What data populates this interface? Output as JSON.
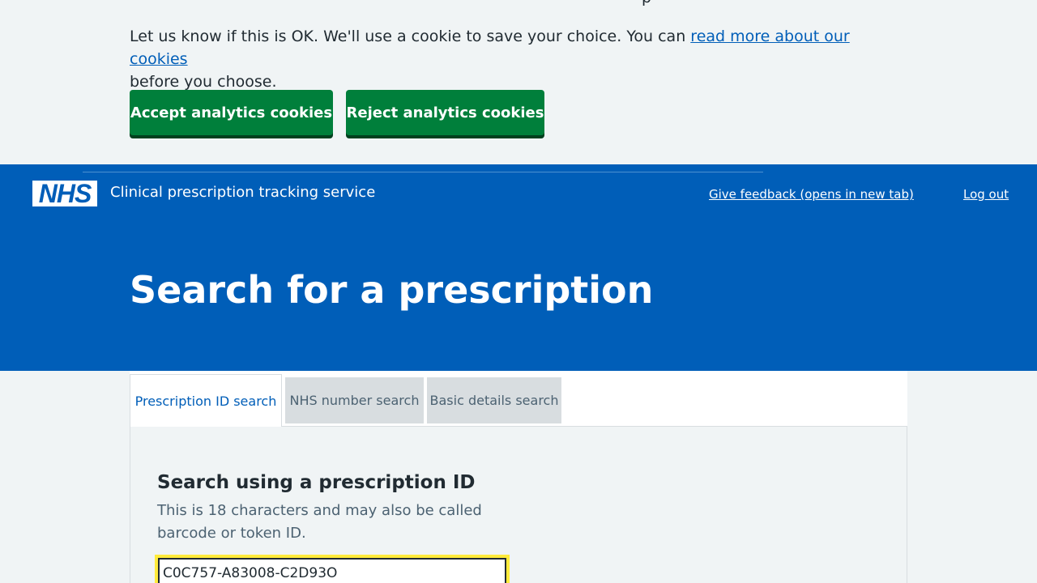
{
  "cookie_banner": {
    "partial_heading": "p",
    "text_before_link": "Let us know if this is OK. We'll use a cookie to save your choice. You can ",
    "link_text": "read more about our cookies",
    "text_after_link": " before you choose.",
    "accept_label": "Accept analytics cookies",
    "reject_label": "Reject analytics cookies"
  },
  "header": {
    "logo_text": "NHS",
    "service_name": "Clinical prescription tracking service",
    "feedback_link": "Give feedback (opens in new tab)",
    "logout_link": "Log out",
    "page_title": "Search for a prescription"
  },
  "tabs": [
    {
      "label": "Prescription ID search",
      "active": true
    },
    {
      "label": "NHS number search",
      "active": false
    },
    {
      "label": "Basic details search",
      "active": false
    }
  ],
  "search_form": {
    "heading": "Search using a prescription ID",
    "hint": "This is 18 characters and may also be called barcode or token ID.",
    "input_value": "C0C757-A83008-C2D93O"
  },
  "colors": {
    "brand_blue": "#005eb8",
    "button_green": "#007f3b",
    "focus_yellow": "#ffeb3b",
    "background": "#f0f4f5"
  }
}
